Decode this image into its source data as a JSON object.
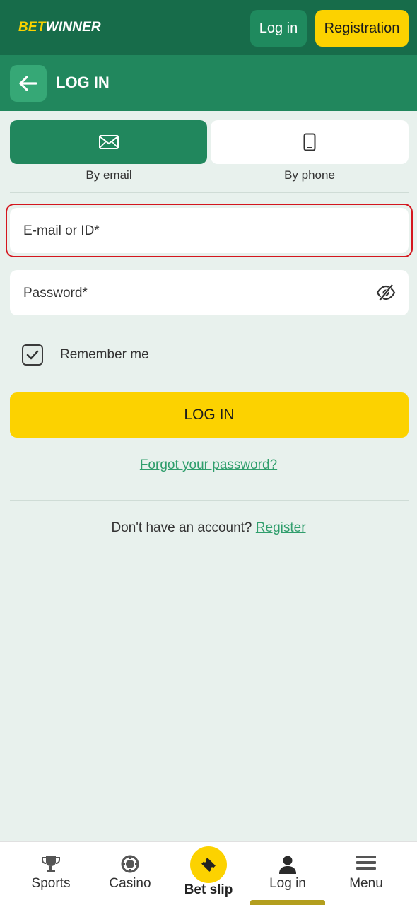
{
  "header": {
    "logo_bet": "BET",
    "logo_winner": "WINNER",
    "login_label": "Log in",
    "registration_label": "Registration"
  },
  "subheader": {
    "title": "LOG IN"
  },
  "tabs": [
    {
      "label": "By email",
      "icon": "envelope-icon",
      "active": true
    },
    {
      "label": "By phone",
      "icon": "phone-icon",
      "active": false
    }
  ],
  "form": {
    "email_placeholder": "E-mail or ID*",
    "password_placeholder": "Password*",
    "remember_label": "Remember me",
    "remember_checked": true,
    "submit_label": "LOG IN",
    "forgot_label": "Forgot your password?",
    "no_account_text": "Don't have an account?",
    "register_link": "Register"
  },
  "bottom_nav": [
    {
      "label": "Sports",
      "icon": "trophy-icon"
    },
    {
      "label": "Casino",
      "icon": "casino-chip-icon"
    },
    {
      "label": "Bet slip",
      "icon": "ticket-icon"
    },
    {
      "label": "Log in",
      "icon": "user-icon",
      "active": true
    },
    {
      "label": "Menu",
      "icon": "hamburger-icon"
    }
  ],
  "colors": {
    "dark_green": "#176c4a",
    "green": "#21875d",
    "yellow": "#fcd200",
    "link_green": "#2f9e6c",
    "highlight_red": "#d4161e",
    "background": "#e8f1ed"
  }
}
